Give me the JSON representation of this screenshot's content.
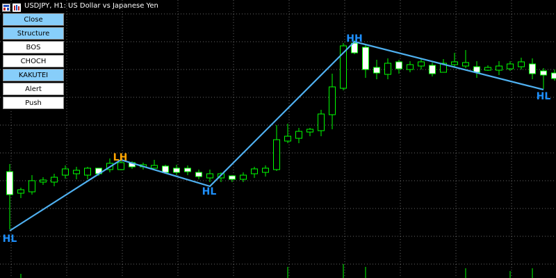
{
  "window": {
    "title": "USDJPY, H1:  US Dollar vs Japanese Yen"
  },
  "panel": {
    "buttons": [
      {
        "label": "Close",
        "active": true
      },
      {
        "label": "Structure",
        "active": true
      },
      {
        "label": "BOS",
        "active": false
      },
      {
        "label": "CHOCH",
        "active": false
      },
      {
        "label": "KAKUTEI",
        "active": true
      },
      {
        "label": "Alert",
        "active": false
      },
      {
        "label": "Push",
        "active": false
      }
    ]
  },
  "colors": {
    "background": "#000000",
    "grid": "#c0c0c0",
    "bull_body": "#000000",
    "bear_body": "#ffffff",
    "wick": "#00ff00",
    "structure_line": "#4fb0f0",
    "hl_label": "#1e90ff",
    "lh_label": "#ffa500",
    "button_active": "#87cefa",
    "button_inactive": "#ffffff"
  },
  "chart": {
    "symbol": "USDJPY",
    "timeframe": "H1",
    "swing_labels": [
      {
        "text": "HL",
        "type": "low"
      },
      {
        "text": "LH",
        "type": "high"
      },
      {
        "text": "HL",
        "type": "low"
      },
      {
        "text": "HH",
        "type": "high"
      },
      {
        "text": "HL",
        "type": "low"
      }
    ]
  }
}
